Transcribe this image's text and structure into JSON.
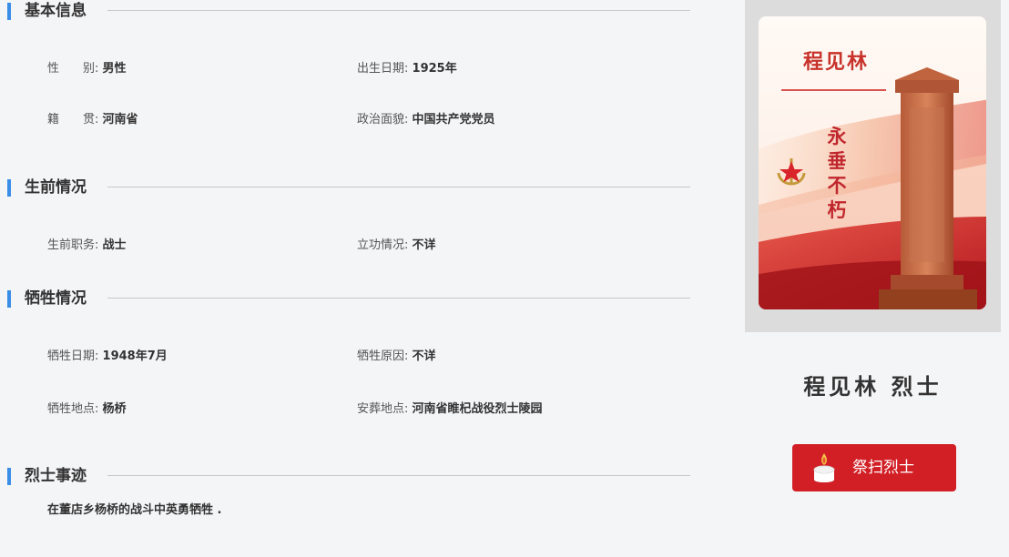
{
  "sections": {
    "basic": {
      "title": "基本信息",
      "gender": {
        "key": "性　　别:",
        "value": "男性"
      },
      "birth": {
        "key": "出生日期:",
        "value": "1925年"
      },
      "native": {
        "key": "籍　　贯:",
        "value": "河南省"
      },
      "political": {
        "key": "政治面貌:",
        "value": "中国共产党党员"
      }
    },
    "life": {
      "title": "生前情况",
      "duty": {
        "key": "生前职务:",
        "value": "战士"
      },
      "merit": {
        "key": "立功情况:",
        "value": "不详"
      }
    },
    "sacrifice": {
      "title": "牺牲情况",
      "date": {
        "key": "牺牲日期:",
        "value": "1948年7月"
      },
      "reason": {
        "key": "牺牲原因:",
        "value": "不详"
      },
      "place": {
        "key": "牺牲地点:",
        "value": "杨桥"
      },
      "burial": {
        "key": "安葬地点:",
        "value": "河南省睢杞战役烈士陵园"
      }
    },
    "deeds": {
      "title": "烈士事迹",
      "text": "在董店乡杨桥的战斗中英勇牺牲 ."
    }
  },
  "poster": {
    "name": "程见林",
    "motto": "永垂不朽"
  },
  "sidebar": {
    "name_title": "程见林 烈士",
    "tribute_button": "祭扫烈士"
  },
  "colors": {
    "accent_bar": "#3a8ee6",
    "button": "#d11f25",
    "poster_red": "#c8332b"
  },
  "icons": {
    "emblem": "navy-star-anchor-icon",
    "candle": "candle-icon"
  }
}
